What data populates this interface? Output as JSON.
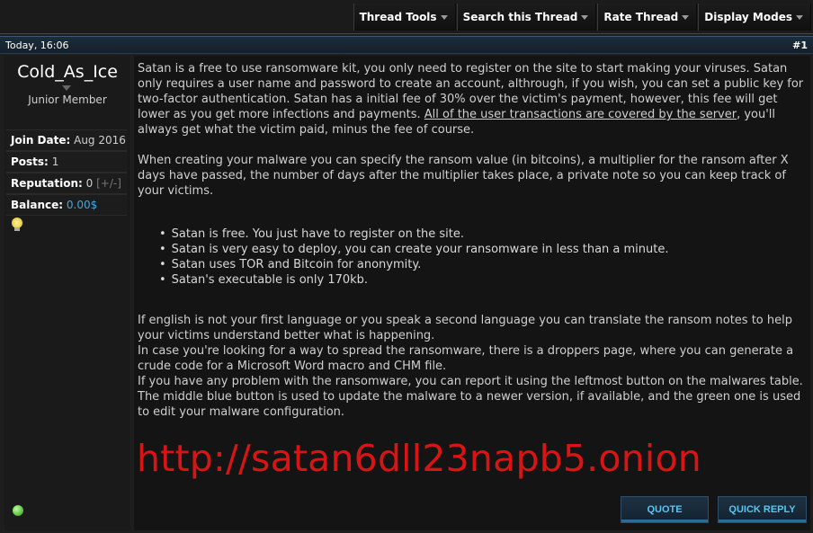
{
  "toolbar": {
    "items": [
      {
        "label": "Thread Tools"
      },
      {
        "label": "Search this Thread"
      },
      {
        "label": "Rate Thread"
      },
      {
        "label": "Display Modes"
      }
    ]
  },
  "post": {
    "date": "Today, 16:06",
    "number": "#1"
  },
  "user": {
    "name": "Cold_As_Ice",
    "title": "Junior Member",
    "join_label": "Join Date:",
    "join_value": "Aug 2016",
    "posts_label": "Posts:",
    "posts_value": "1",
    "rep_label": "Reputation:",
    "rep_value": "0",
    "rep_controls": "[+/-]",
    "balance_label": "Balance:",
    "balance_value": "0.00$"
  },
  "body": {
    "p1_a": "Satan is a free to use ransomware kit, you only need to register on the site to start making your viruses. Satan only requires a user name and password to create an account, althrough, if you wish, you can set a public key for two-factor authentication. Satan has a initial fee of 30% over the victim's payment, however, this fee will get lower as you get more infections and payments.",
    "p1_link": "All of the user transactions are covered by the server",
    "p1_b": ", you'll always get what the victim paid, minus the fee of course.",
    "p2": "When creating your malware you can specify the ransom value (in bitcoins), a multiplier for the ransom after X days have passed, the number of days after the multiplier takes place, a private note so you can keep track of your victims.",
    "bullets": [
      "Satan is free. You just have to register on the site.",
      "Satan is very easy to deploy, you can create your ransomware in less than a minute.",
      "Satan uses TOR and Bitcoin for anonymity.",
      "Satan's executable is only 170kb."
    ],
    "p3": "If english is not your first language or you speak a second language you can translate the ransom notes to help your victims understand better what is happening.",
    "p4": "In case you're looking for a way to spread the ransomware, there is a droppers page, where you can generate a crude code for a Microsoft Word macro and CHM file.",
    "p5": "If you have any problem with the ransomware, you can report it using the leftmost button on the malwares table. The middle blue button is used to update the malware to a newer version, if available, and the green one is used to edit your malware configuration.",
    "url": "http://satan6dll23napb5.onion"
  },
  "actions": {
    "quote": "QUOTE",
    "quick_reply": "QUICK REPLY"
  },
  "colors": {
    "accent": "#59c6f0",
    "url": "#d81414",
    "link": "#3fa7e0"
  }
}
